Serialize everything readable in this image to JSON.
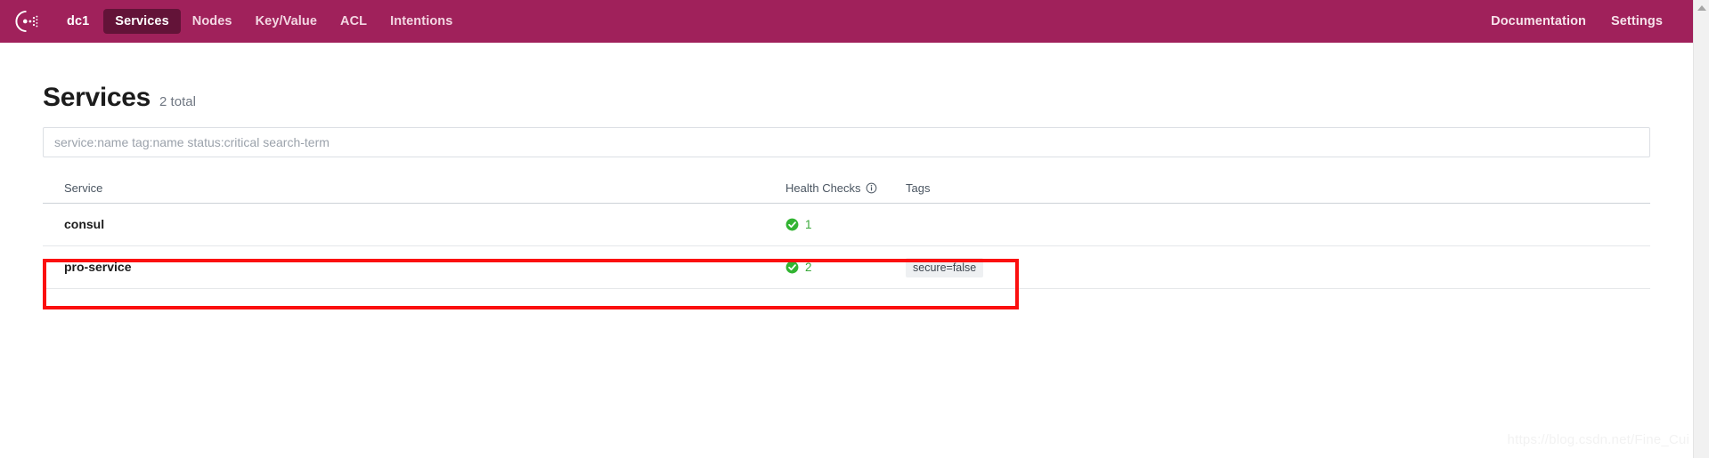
{
  "navbar": {
    "logo_icon": "consul-logo-icon",
    "background_color": "#a0215b",
    "active_background_color": "#631338",
    "datacenter": "dc1",
    "left_items": [
      {
        "label": "Services",
        "active": true
      },
      {
        "label": "Nodes",
        "active": false
      },
      {
        "label": "Key/Value",
        "active": false
      },
      {
        "label": "ACL",
        "active": false
      },
      {
        "label": "Intentions",
        "active": false
      }
    ],
    "right_items": [
      {
        "label": "Documentation"
      },
      {
        "label": "Settings"
      }
    ]
  },
  "page": {
    "title": "Services",
    "count_label": "2 total"
  },
  "search": {
    "placeholder": "service:name tag:name status:critical search-term",
    "value": ""
  },
  "table": {
    "headers": {
      "service": "Service",
      "health_checks": "Health Checks",
      "health_checks_info_icon": "info-icon",
      "tags": "Tags"
    },
    "rows": [
      {
        "service": "consul",
        "health_status_icon": "check-circle-icon",
        "health_status_color": "#3aa93a",
        "health_count": "1",
        "tags": []
      },
      {
        "service": "pro-service",
        "health_status_icon": "check-circle-icon",
        "health_status_color": "#3aa93a",
        "health_count": "2",
        "tags": [
          "secure=false"
        ],
        "highlighted": true
      }
    ]
  },
  "annotation": {
    "color": "#fb0f0f",
    "target_row": "pro-service"
  },
  "watermark": {
    "text": "https://blog.csdn.net/Fine_Cui"
  }
}
